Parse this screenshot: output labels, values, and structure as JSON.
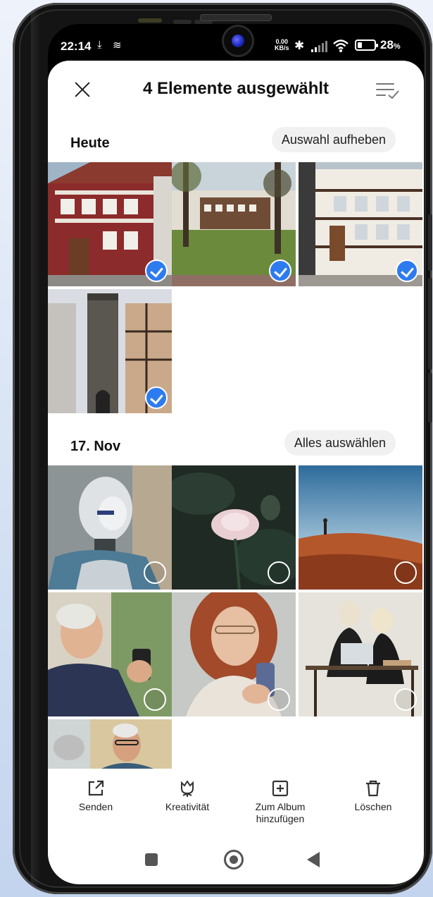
{
  "status": {
    "time": "22:14",
    "net_speed_value": "0.00",
    "net_speed_unit": "KB/s",
    "battery": "28",
    "battery_unit": "%"
  },
  "topbar": {
    "title": "4 Elemente ausgewählt"
  },
  "sections": [
    {
      "label": "Heute",
      "action": "Auswahl aufheben"
    },
    {
      "label": "17. Nov",
      "action": "Alles auswählen"
    }
  ],
  "photos_today": [
    {
      "subject": "half-timbered house",
      "selected": true
    },
    {
      "subject": "town square with trees",
      "selected": true
    },
    {
      "subject": "half-timbered street",
      "selected": true
    },
    {
      "subject": "stone tower",
      "selected": true
    }
  ],
  "photos_nov17": [
    {
      "subject": "robot",
      "selected": false
    },
    {
      "subject": "pink flower",
      "selected": false
    },
    {
      "subject": "person on dune",
      "selected": false
    },
    {
      "subject": "senior man with phone",
      "selected": false
    },
    {
      "subject": "woman with phone",
      "selected": false
    },
    {
      "subject": "two women at laptop",
      "selected": false
    },
    {
      "subject": "man with glasses",
      "selected": false
    }
  ],
  "actions": [
    {
      "label": "Senden",
      "icon": "share-icon"
    },
    {
      "label": "Kreativität",
      "icon": "tulip-icon"
    },
    {
      "label": "Zum Album hinzufügen",
      "icon": "add-box-icon"
    },
    {
      "label": "Löschen",
      "icon": "trash-icon"
    }
  ],
  "colors": {
    "accent": "#2e7bf0"
  }
}
